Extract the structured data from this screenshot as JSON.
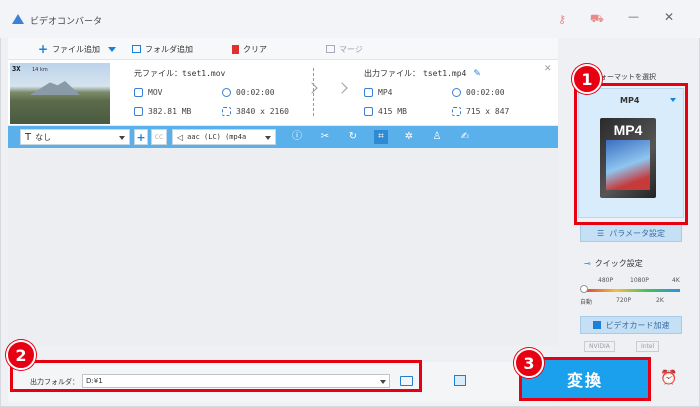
{
  "window": {
    "title": "ビデオコンバータ"
  },
  "toolbar": {
    "add_file": "ファイル追加",
    "add_folder": "フォルダ追加",
    "clear": "クリア",
    "merge": "マージ"
  },
  "file": {
    "thumb_tag": "3X",
    "thumb_sub": "14 km",
    "source_label": "元ファイル：",
    "source_name": "tset1.mov",
    "source_format": "MOV",
    "source_duration": "00:02:00",
    "source_size": "382.81 MB",
    "source_resolution": "3840 x 2160",
    "output_label": "出力ファイル：",
    "output_name": "tset1.mp4",
    "output_format": "MP4",
    "output_duration": "00:02:00",
    "output_size": "415 MB",
    "output_resolution": "715 x 847"
  },
  "editbar": {
    "subtitle_value": "なし",
    "audio_value": "aac (LC) (mp4a"
  },
  "sidebar": {
    "format_heading": "ォーマットを選択",
    "selected_format": "MP4",
    "icon_label": "MP4",
    "param_button": "パラメータ設定",
    "quick_setting": "クイック設定",
    "quality_ticks_top": [
      "480P",
      "1080P",
      "4K"
    ],
    "quality_ticks_bottom": [
      "自動",
      "720P",
      "2K"
    ],
    "gpu_button": "ビデオカード加速",
    "gpu_vendors": [
      "NVIDIA",
      "Intel"
    ]
  },
  "bottom": {
    "output_folder_label": "出力フォルダ：",
    "output_folder_value": "D:¥1"
  },
  "convert": {
    "label": "変換"
  },
  "badges": [
    "1",
    "2",
    "3"
  ],
  "colors": {
    "accent": "#1aa0ec",
    "highlight": "#e60012",
    "edit_bar": "#5ab0ea"
  }
}
